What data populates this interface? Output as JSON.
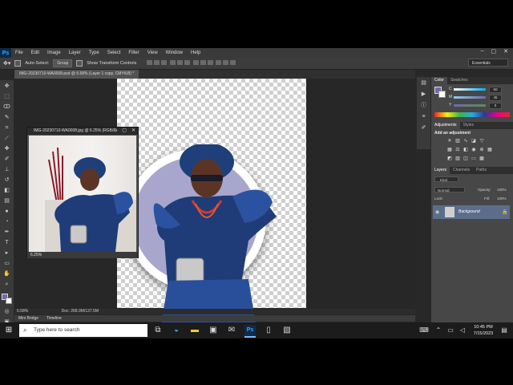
{
  "app": {
    "logo": "Ps",
    "menus": [
      "File",
      "Edit",
      "Image",
      "Layer",
      "Type",
      "Select",
      "Filter",
      "View",
      "Window",
      "Help"
    ]
  },
  "window_controls": [
    "–",
    "▢",
    "✕"
  ],
  "options": {
    "auto_select_label": "Auto-Select:",
    "auto_select_value": "Group",
    "transform_label": "Show Transform Controls",
    "workspace": "Essentials"
  },
  "document_tab": "IMG-20230710-WA0008.psd @ 6.58% (Layer 1 copy, CMYK/8) *",
  "floating_window": {
    "title": "IMG-20230710-WA0008.jpg @ 6.25% (RGB/8)",
    "zoom": "6.25%"
  },
  "status": {
    "zoom": "6.58%",
    "doc": "Doc: 268.9M/137.5M"
  },
  "bottom_tabs": [
    "Mini Bridge",
    "Timeline"
  ],
  "color_panel": {
    "tabs": [
      "Color",
      "Swatches"
    ],
    "sliders": [
      {
        "label": "C",
        "value": "50"
      },
      {
        "label": "M",
        "value": "45"
      },
      {
        "label": "Y",
        "value": "0"
      }
    ]
  },
  "adjustments_panel": {
    "tabs": [
      "Adjustments",
      "Styles"
    ],
    "heading": "Add an adjustment"
  },
  "layers_panel": {
    "tabs": [
      "Layers",
      "Channels",
      "Paths"
    ],
    "kind": "Kind",
    "blend": "Normal",
    "opacity_label": "Opacity:",
    "opacity": "100%",
    "lock_label": "Lock:",
    "fill_label": "Fill:",
    "fill": "100%",
    "layer_name": "Background"
  },
  "taskbar": {
    "search_placeholder": "Type here to search",
    "time": "10:45 PM",
    "date": "7/15/2023"
  },
  "colors": {
    "accent": "#31a8ff",
    "layer_selected": "#5a6e8c",
    "circle_fill": "#a8a6cc"
  }
}
